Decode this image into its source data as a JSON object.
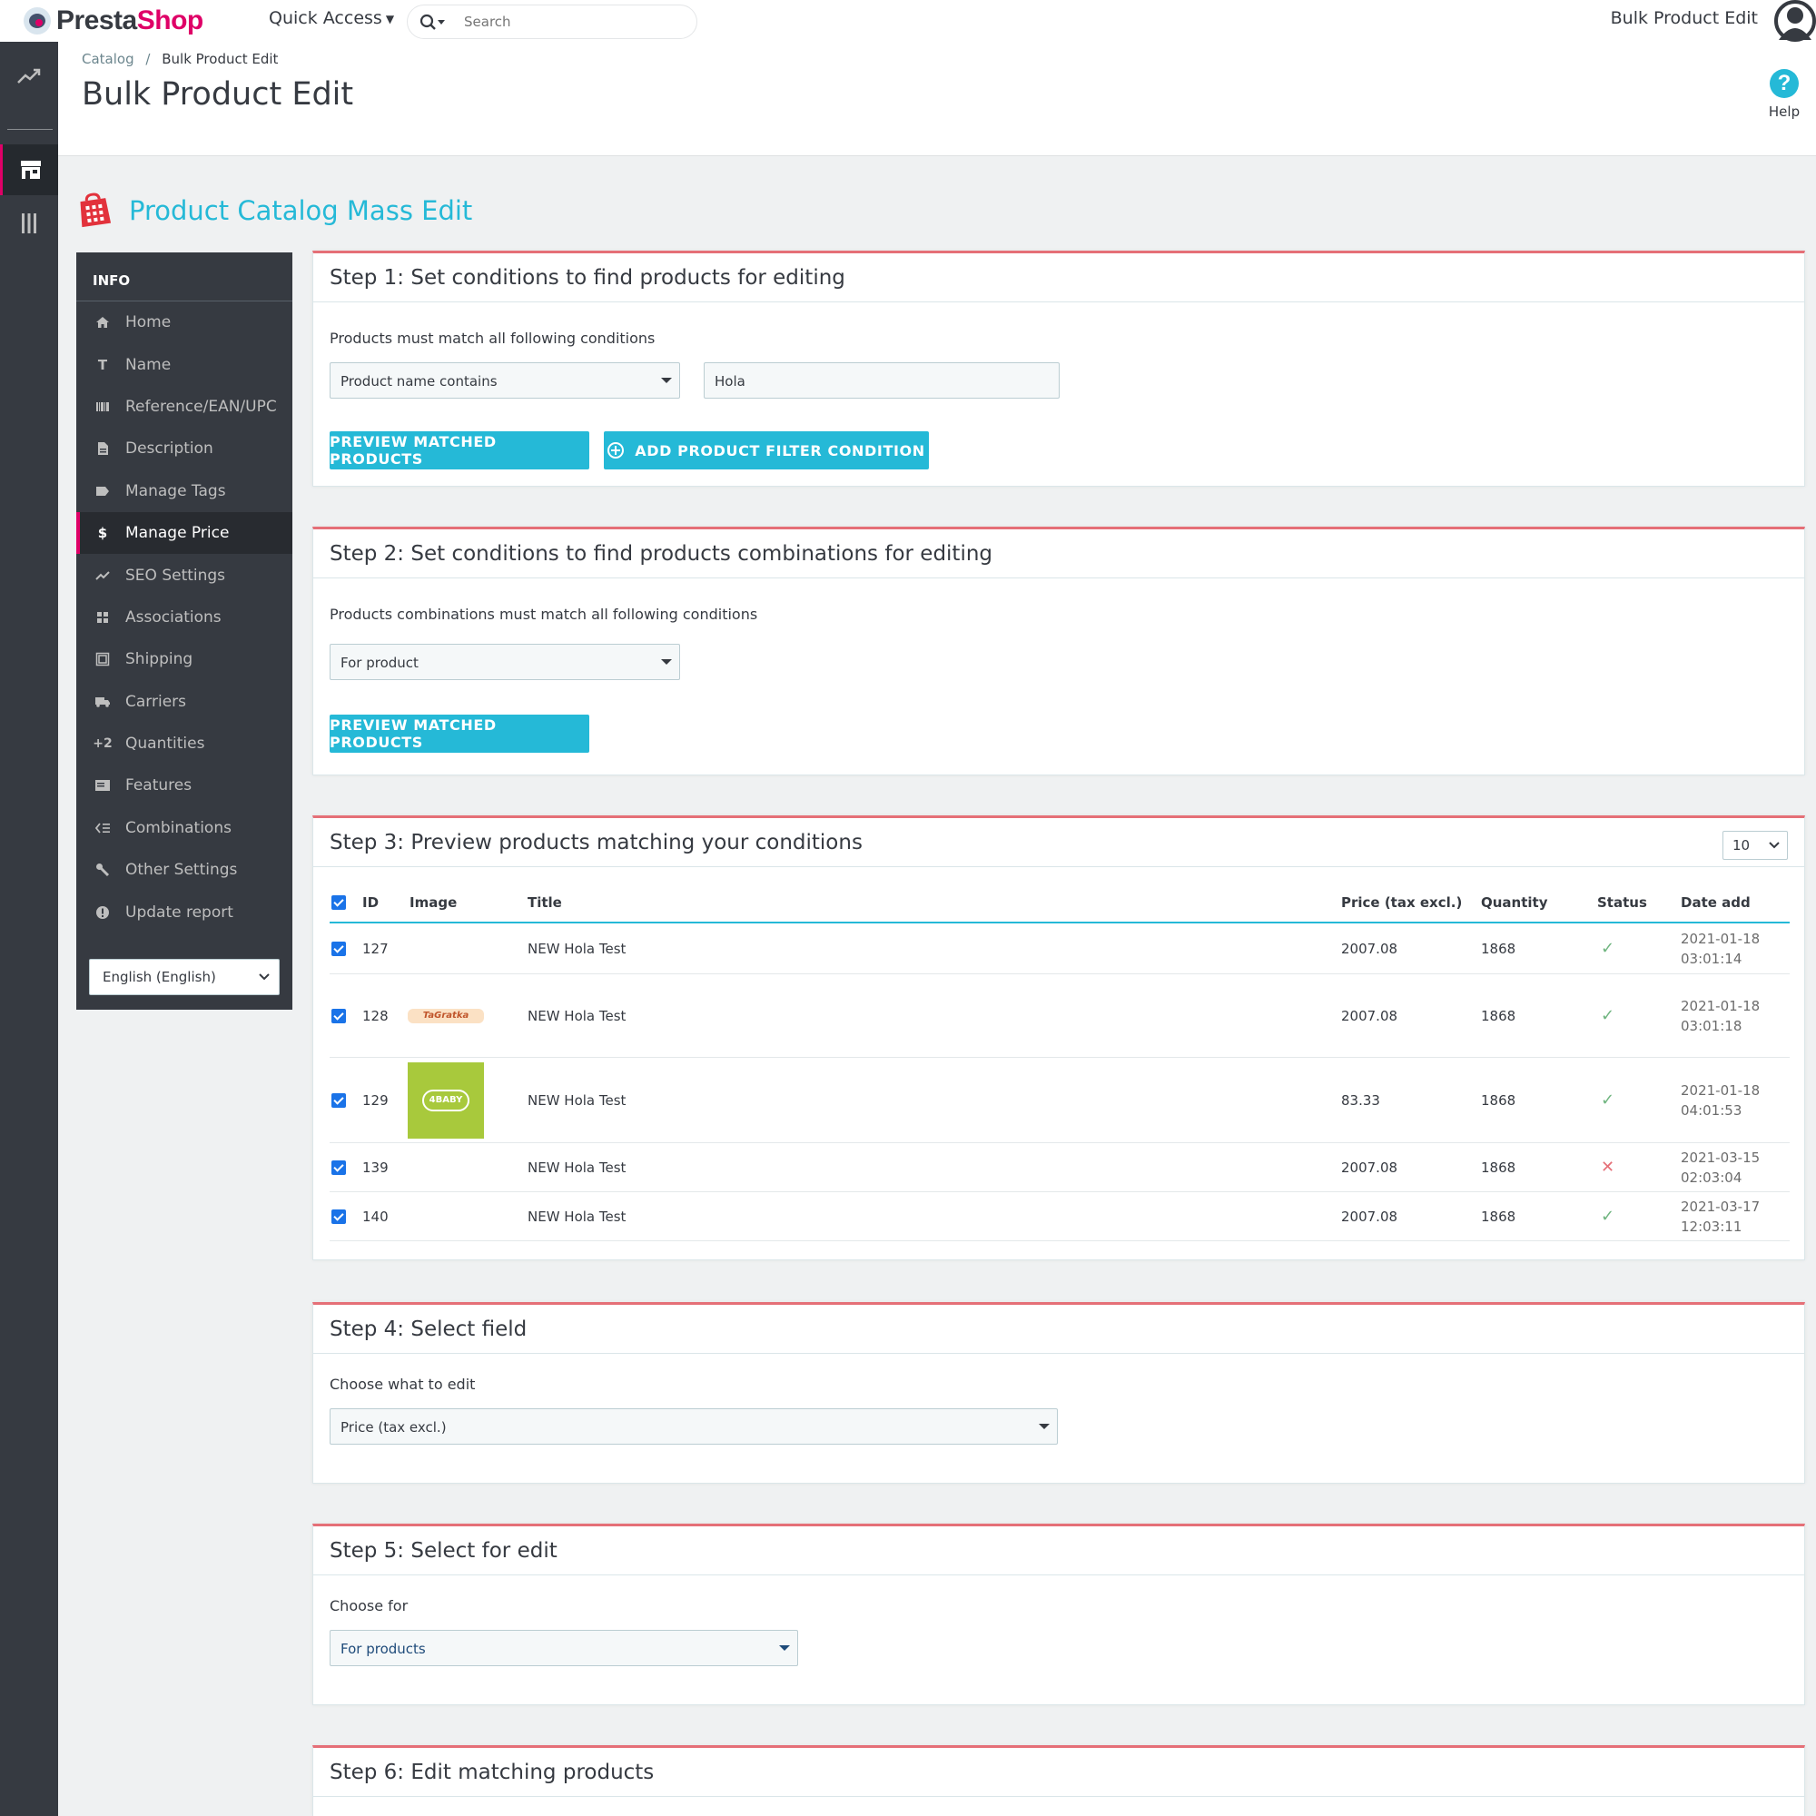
{
  "header": {
    "logo_part1": "Presta",
    "logo_part2": "Shop",
    "quick_access": "Quick Access",
    "search_placeholder": "Search",
    "shop_name": "Bulk Product Edit"
  },
  "breadcrumb": {
    "parent": "Catalog",
    "separator": "/",
    "current": "Bulk Product Edit"
  },
  "page_title": "Bulk Product Edit",
  "help_label": "Help",
  "module_title": "Product Catalog Mass Edit",
  "sidebar": {
    "header": "INFO",
    "items": [
      {
        "label": "Home",
        "icon": "home-icon"
      },
      {
        "label": "Name",
        "icon": "text-icon"
      },
      {
        "label": "Reference/EAN/UPC",
        "icon": "barcode-icon"
      },
      {
        "label": "Description",
        "icon": "file-icon"
      },
      {
        "label": "Manage Tags",
        "icon": "tag-icon"
      },
      {
        "label": "Manage Price",
        "icon": "dollar-icon"
      },
      {
        "label": "SEO Settings",
        "icon": "trending-icon"
      },
      {
        "label": "Associations",
        "icon": "grid-icon"
      },
      {
        "label": "Shipping",
        "icon": "box-icon"
      },
      {
        "label": "Carriers",
        "icon": "truck-icon"
      },
      {
        "label": "Quantities",
        "icon": "plus-two-icon"
      },
      {
        "label": "Features",
        "icon": "card-icon"
      },
      {
        "label": "Combinations",
        "icon": "list-icon"
      },
      {
        "label": "Other Settings",
        "icon": "wrench-icon"
      },
      {
        "label": "Update report",
        "icon": "info-icon"
      }
    ],
    "language": "English (English)"
  },
  "step1": {
    "title": "Step 1: Set conditions to find products for editing",
    "label": "Products must match all following conditions",
    "condition_select": "Product name contains",
    "condition_value": "Hola",
    "preview_button": "PREVIEW MATCHED PRODUCTS",
    "add_condition_button": "ADD PRODUCT FILTER CONDITION"
  },
  "step2": {
    "title": "Step 2: Set conditions to find products combinations for editing",
    "label": "Products combinations must match all following conditions",
    "select": "For product",
    "preview_button": "PREVIEW MATCHED PRODUCTS"
  },
  "step3": {
    "title": "Step 3: Preview products matching your conditions",
    "per_page": "10",
    "columns": [
      "ID",
      "Image",
      "Title",
      "Price (tax excl.)",
      "Quantity",
      "Status",
      "Date add"
    ],
    "rows": [
      {
        "id": "127",
        "image": "",
        "title": "NEW Hola Test",
        "price": "2007.08",
        "qty": "1868",
        "status": "✓",
        "date": "2021-01-18",
        "time": "03:01:14"
      },
      {
        "id": "128",
        "image": "TaGratka",
        "title": "NEW Hola Test",
        "price": "2007.08",
        "qty": "1868",
        "status": "✓",
        "date": "2021-01-18",
        "time": "03:01:18"
      },
      {
        "id": "129",
        "image": "4BABY",
        "title": "NEW Hola Test",
        "price": "83.33",
        "qty": "1868",
        "status": "✓",
        "date": "2021-01-18",
        "time": "04:01:53"
      },
      {
        "id": "139",
        "image": "",
        "title": "NEW Hola Test",
        "price": "2007.08",
        "qty": "1868",
        "status": "✕",
        "date": "2021-03-15",
        "time": "02:03:04"
      },
      {
        "id": "140",
        "image": "",
        "title": "NEW Hola Test",
        "price": "2007.08",
        "qty": "1868",
        "status": "✓",
        "date": "2021-03-17",
        "time": "12:03:11"
      }
    ]
  },
  "step4": {
    "title": "Step 4: Select field",
    "label": "Choose what to edit",
    "select": "Price (tax excl.)"
  },
  "step5": {
    "title": "Step 5: Select for edit",
    "label": "Choose for",
    "select": "For products"
  },
  "step6": {
    "title": "Step 6: Edit matching products"
  },
  "colors": {
    "accent": "#25b9d7",
    "brand": "#df0067",
    "panel_top": "#e56f77",
    "nav_bg": "#363a41",
    "ok": "#70b580",
    "ko": "#e56f77"
  }
}
